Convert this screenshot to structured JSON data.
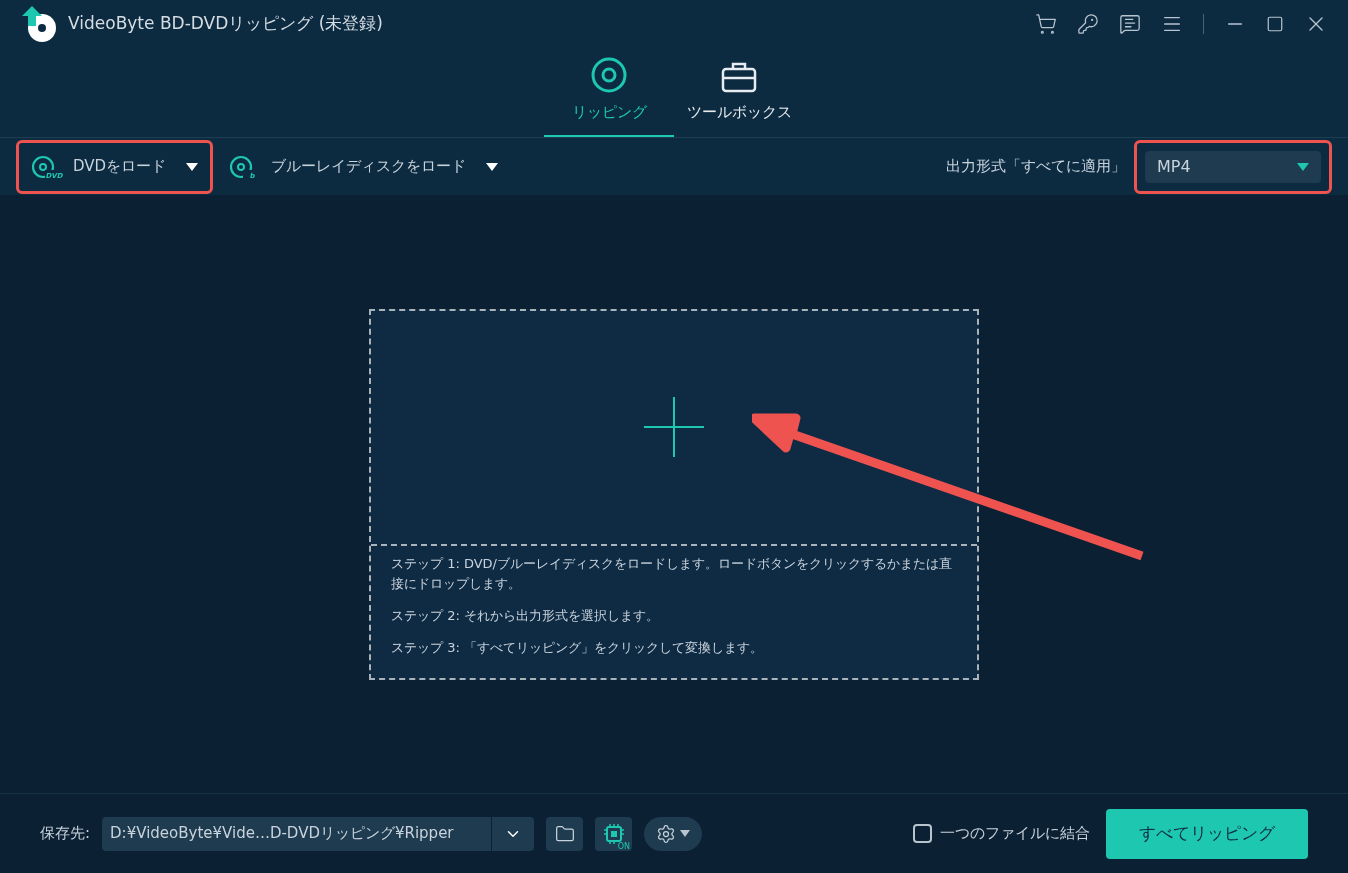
{
  "window": {
    "title": "VideoByte BD-DVDリッピング (未登録)"
  },
  "tabs": [
    {
      "label": "リッピング",
      "kind": "disc",
      "selected": true
    },
    {
      "label": "ツールボックス",
      "kind": "toolbox",
      "selected": false
    }
  ],
  "toolbar": {
    "dvd_icon_text": "DVD",
    "bluray_icon_text": "b",
    "load_dvd": "DVDをロード",
    "load_bluray": "ブルーレイディスクをロード",
    "format_label": "出力形式「すべてに適用」",
    "format_value": "MP4"
  },
  "drop_area": {
    "steps": [
      "ステップ 1: DVD/ブルーレイディスクをロードします。ロードボタンをクリックするかまたは直接にドロップします。",
      "ステップ 2: それから出力形式を選択します。",
      "ステップ 3: 「すべてリッピング」をクリックして変換します。"
    ]
  },
  "bottom": {
    "save_label": "保存先:",
    "save_path": "D:¥VideoByte¥Vide…D-DVDリッピング¥Ripper",
    "gpu_badge": "ON",
    "merge_label": "一つのファイルに結合",
    "merge_checked": false,
    "rip_button": "すべてリッピング"
  }
}
